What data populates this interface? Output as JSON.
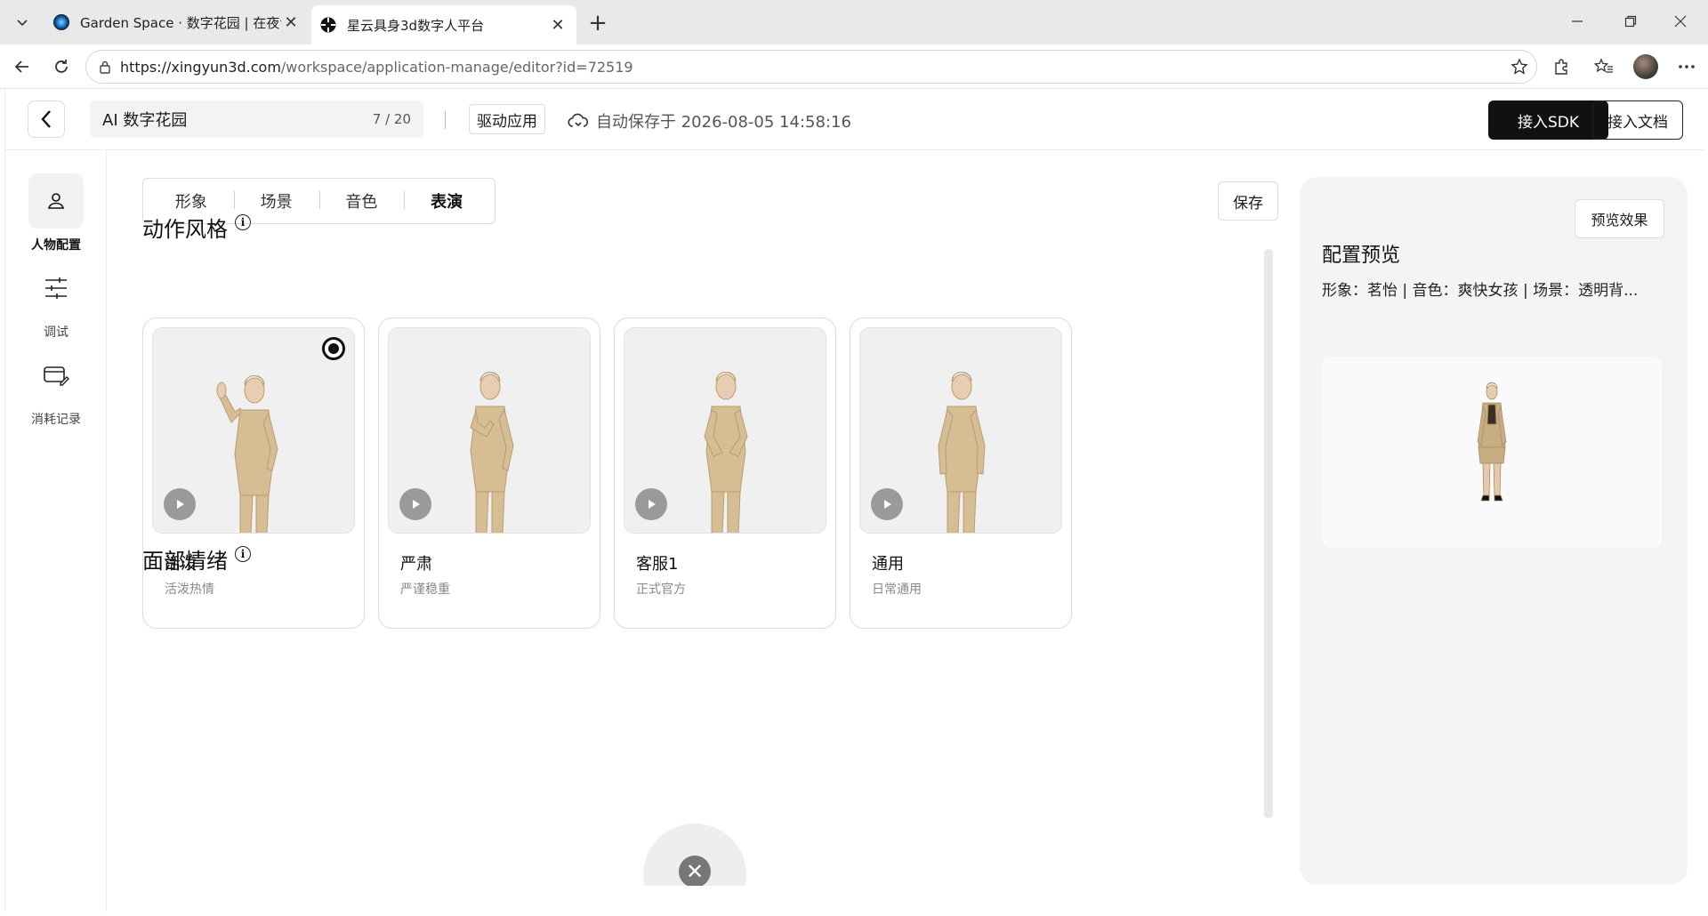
{
  "browser": {
    "tabs": [
      {
        "title": "Garden Space · 数字花园 | 在夜色里",
        "active": false,
        "favicon": "garden-space-favicon"
      },
      {
        "title": "星云具身3d数字人平台",
        "active": true,
        "favicon": "xingyun-favicon"
      }
    ],
    "url_host": "https://xingyun3d.com",
    "url_path": "/workspace/application-manage/editor?id=72519"
  },
  "header": {
    "app_name": "AI 数字花园",
    "name_count": "7 / 20",
    "drive_label": "驱动应用",
    "autosave_text": "自动保存于 2026-08-05 14:58:16",
    "sdk_label": "接入SDK",
    "doc_label": "接入文档"
  },
  "sidebar": {
    "items": [
      {
        "label": "人物配置",
        "icon": "person-icon",
        "active": true
      },
      {
        "label": "调试",
        "icon": "sliders-icon",
        "active": false
      },
      {
        "label": "消耗记录",
        "icon": "card-edit-icon",
        "active": false
      }
    ]
  },
  "tabs": [
    {
      "label": "形象",
      "active": false
    },
    {
      "label": "场景",
      "active": false
    },
    {
      "label": "音色",
      "active": false
    },
    {
      "label": "表演",
      "active": true
    }
  ],
  "save_label": "保存",
  "motion_section": {
    "title": "动作风格",
    "cards": [
      {
        "title": "活泼",
        "desc": "活泼热情",
        "selected": true,
        "pose": "wave"
      },
      {
        "title": "严肃",
        "desc": "严谨稳重",
        "selected": false,
        "pose": "hand-on-chest"
      },
      {
        "title": "客服1",
        "desc": "正式官方",
        "selected": false,
        "pose": "hands-clasped"
      },
      {
        "title": "通用",
        "desc": "日常通用",
        "selected": false,
        "pose": "arms-down"
      }
    ]
  },
  "face_section": {
    "title": "面部情绪"
  },
  "preview": {
    "button_label": "预览效果",
    "title": "配置预览",
    "summary": "形象：茗怡 | 音色：爽快女孩 | 场景：透明背..."
  },
  "colors": {
    "primary_button": "#111111",
    "panel_bg": "#f4f4f4",
    "suit": "#d8bf96"
  }
}
